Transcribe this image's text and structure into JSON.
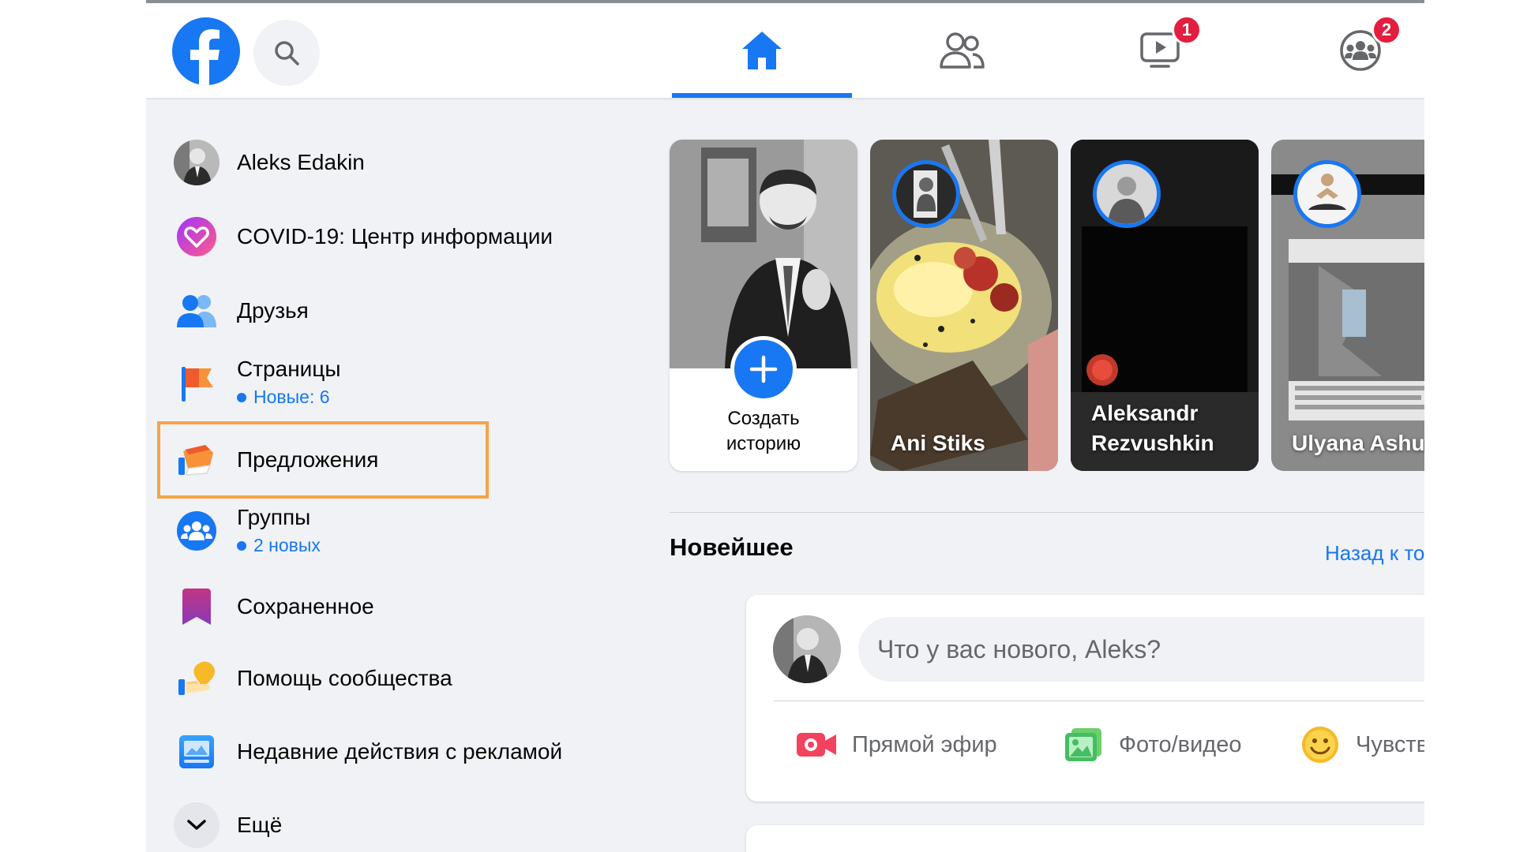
{
  "colors": {
    "accent": "#1877f2",
    "highlight": "#f5a449",
    "badge": "#e41e3f"
  },
  "topbar": {
    "logo_icon": "facebook-logo",
    "search_icon": "search-icon",
    "tabs": [
      {
        "name": "home",
        "icon": "home-icon",
        "active": true
      },
      {
        "name": "friends",
        "icon": "friends-icon"
      },
      {
        "name": "watch",
        "icon": "video-icon",
        "badge": "1"
      },
      {
        "name": "groups",
        "icon": "groups-icon",
        "badge": "2"
      }
    ]
  },
  "sidebar": {
    "items": [
      {
        "label": "Aleks Edakin",
        "icon": "avatar"
      },
      {
        "label": "COVID-19: Центр информации",
        "icon": "covid-heart-icon"
      },
      {
        "label": "Друзья",
        "icon": "friends-icon"
      },
      {
        "label": "Страницы",
        "sub": "Новые: 6",
        "icon": "flag-icon"
      },
      {
        "label": "Предложения",
        "icon": "offers-icon",
        "highlighted": true
      },
      {
        "label": "Группы",
        "sub": "2 новых",
        "icon": "groups-icon"
      },
      {
        "label": "Сохраненное",
        "icon": "bookmark-icon"
      },
      {
        "label": "Помощь сообщества",
        "icon": "community-help-icon"
      },
      {
        "label": "Недавние действия с рекламой",
        "icon": "ad-activity-icon"
      },
      {
        "label": "Ещё",
        "icon": "chevron-down-icon"
      }
    ]
  },
  "stories": {
    "create_label": "Создать историю",
    "items": [
      {
        "name": "Ani Stiks"
      },
      {
        "name": "Aleksandr Rezvushkin"
      },
      {
        "name": "Ulyana Ashurka"
      }
    ]
  },
  "feed": {
    "title": "Новейшее",
    "back_link": "Назад к то",
    "composer": {
      "placeholder": "Что у вас нового, Aleks?",
      "actions": [
        {
          "label": "Прямой эфир",
          "icon": "live-video-icon"
        },
        {
          "label": "Фото/видео",
          "icon": "photo-icon"
        },
        {
          "label": "Чувства",
          "icon": "smile-icon"
        }
      ]
    }
  }
}
